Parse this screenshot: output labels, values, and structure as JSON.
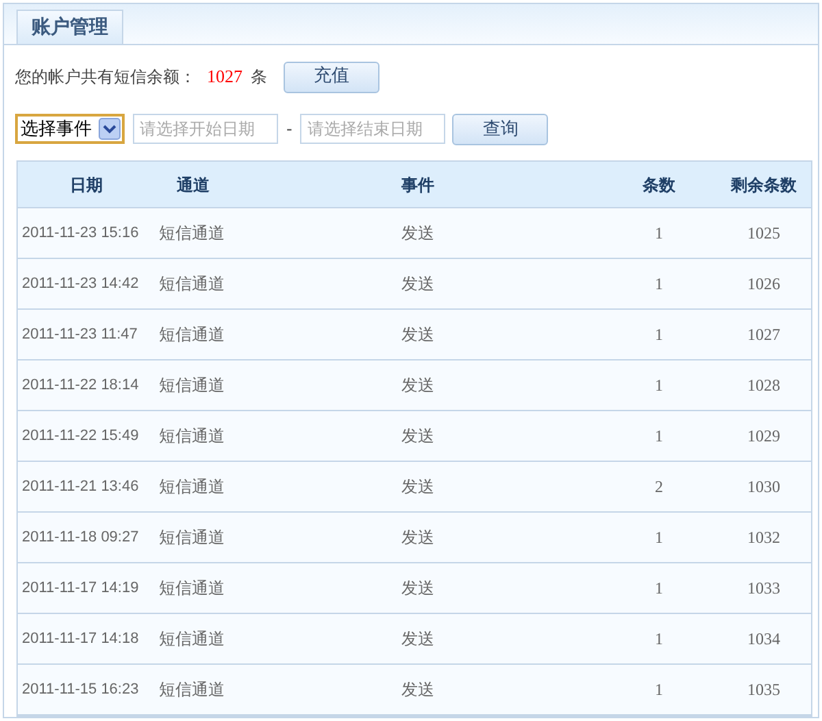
{
  "tab": {
    "label": "账户管理",
    "selected": true
  },
  "balance": {
    "label": "您的帐户共有短信余额：",
    "amount": "1027",
    "unit": "条",
    "button": "充值"
  },
  "filter": {
    "event_select": "选择事件",
    "start_date": {
      "placeholder": "请选择开始日期"
    },
    "separator": "-",
    "end_date": {
      "placeholder": "请选择结束日期"
    },
    "button": "查询"
  },
  "table": {
    "columns": [
      "日期",
      "通道",
      "事件",
      "条数",
      "剩余条数"
    ],
    "rows": [
      [
        "2011-11-23 15:16",
        "短信通道",
        "发送",
        "1",
        "1025"
      ],
      [
        "2011-11-23 14:42",
        "短信通道",
        "发送",
        "1",
        "1026"
      ],
      [
        "2011-11-23 11:47",
        "短信通道",
        "发送",
        "1",
        "1027"
      ],
      [
        "2011-11-22 18:14",
        "短信通道",
        "发送",
        "1",
        "1028"
      ],
      [
        "2011-11-22 15:49",
        "短信通道",
        "发送",
        "1",
        "1029"
      ],
      [
        "2011-11-21 13:46",
        "短信通道",
        "发送",
        "2",
        "1030"
      ],
      [
        "2011-11-18 09:27",
        "短信通道",
        "发送",
        "1",
        "1032"
      ],
      [
        "2011-11-17 14:19",
        "短信通道",
        "发送",
        "1",
        "1033"
      ],
      [
        "2011-11-17 14:18",
        "短信通道",
        "发送",
        "1",
        "1034"
      ],
      [
        "2011-11-15 16:23",
        "短信通道",
        "发送",
        "1",
        "1035"
      ]
    ]
  }
}
